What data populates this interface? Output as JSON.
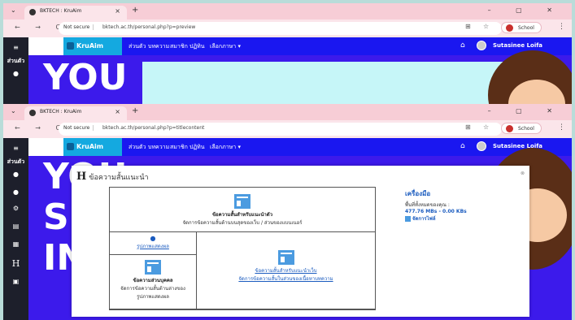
{
  "windows": [
    {
      "tab_title": "BKTECH : KruAim",
      "url": "bktech.ac.th/personal.php?p=preview"
    },
    {
      "tab_title": "BKTECH : KruAim",
      "url": "bktech.ac.th/personal.php?p=titlecontent"
    }
  ],
  "browser": {
    "not_secure": "Not secure",
    "profile_label": "School",
    "new_tab": "+",
    "close_tab": "×",
    "nav_glyphs": "← → C",
    "window_controls": "– ▢ ✕",
    "menu": "⋮",
    "translate": "⊞",
    "star": "☆",
    "tab_menu": "⌄"
  },
  "site": {
    "brand": "KruAim",
    "nav": [
      "ส่วนตัว",
      "บทความ",
      "สมาชิก",
      "ปฏิทิน",
      "เลือกภาษา ▾"
    ],
    "user": "Sutasinee Loifa",
    "home_icon": "⌂",
    "sidebar_label": "ส่วนตัว",
    "sidebar_icons": [
      "≡",
      "●",
      "●",
      "⚙",
      "▤",
      "▦",
      "H",
      "▣"
    ],
    "hero_text_1": "YOU",
    "hero_text_2": "S",
    "hero_text_3": "IN"
  },
  "modal": {
    "title_icon": "H",
    "title": "ข้อความสั้นแนะนำ",
    "close": "⊗",
    "cell_top_title": "ข้อความสั้นสำหรับแนะนำตัว",
    "cell_top_desc": "จัดการข้อความสั้นด้านบนสุดของเว็บ / ส่วนของแบนเนอร์",
    "cell_profile_link": "รูปภาพแสดงผล",
    "cell_personal_title": "ข้อความส่วนบุคคล",
    "cell_personal_desc1": "จัดการข้อความสั้นด้านล่างของ",
    "cell_personal_desc2": "รูปภาพแสดงผล",
    "cell_web_title": "ข้อความสั้นสำหรับแนะนำเว็บ",
    "cell_web_desc": "จัดการข้อความสั้นในส่วนของเนื้อหาบทความ"
  },
  "tools": {
    "heading": "เครื่องมือ",
    "space_label": "พื้นที่ทั้งหมดของคุณ :",
    "space_value": "477.76 MBs - 0.00 KBs",
    "file_manager": "จัดการไฟล์"
  }
}
